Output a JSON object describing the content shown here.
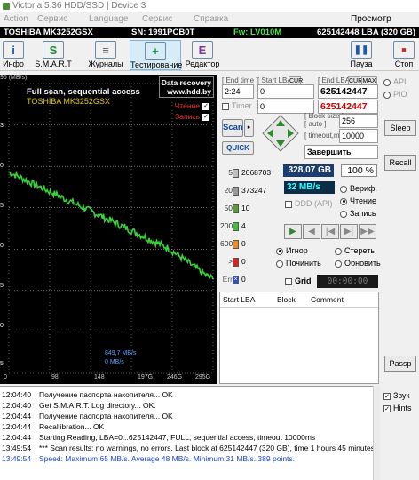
{
  "window": {
    "title": "Victoria 5.36 HDD/SSD | Device 3"
  },
  "menu": [
    "Action",
    "Сервис",
    "Language",
    "Сервис",
    "Справка",
    "Просмотр буфера"
  ],
  "info": {
    "model": "TOSHIBA MK3252GSX",
    "serial": "SN: 1991PCB0T",
    "firmware": "Fw: LV010M",
    "capacity": "625142448 LBA (320 GB)"
  },
  "toolbar": {
    "items": [
      {
        "label": "Инфо",
        "icon": "i"
      },
      {
        "label": "S.M.A.R.T",
        "icon": "S"
      },
      {
        "label": "Журналы",
        "icon": "≡"
      },
      {
        "label": "Тестирование",
        "icon": "+"
      },
      {
        "label": "Редактор",
        "icon": "E"
      }
    ],
    "pause": "Пауза",
    "stop": "Стоп"
  },
  "graph": {
    "unit": "95 (MB/s)",
    "title": "Full scan, sequential access",
    "model": "TOSHIBA MK3252GSX",
    "recovery_line1": "Data recovery",
    "recovery_line2": "www.hdd.by",
    "read_label": "Чтение",
    "write_label": "Запись",
    "speed_readout": "849,7 MB/s",
    "speed_readout2": "0 MB/s",
    "y_ticks": [
      "3",
      "0",
      "5",
      "0",
      "5",
      "0",
      "5"
    ],
    "x_ticks": [
      "0",
      "98",
      "148",
      "197G",
      "246G",
      "295G"
    ],
    "colors": {
      "line": "#3bd23b",
      "grid": "#a8a8a8"
    }
  },
  "chart_data": {
    "type": "line",
    "title": "Full scan, sequential access",
    "ylabel": "(MB/s)",
    "xlabel": "",
    "xlim": [
      0,
      320
    ],
    "ylim": [
      0,
      95
    ],
    "x": [
      0,
      10,
      20,
      30,
      40,
      50,
      60,
      70,
      80,
      90,
      100,
      110,
      120,
      130,
      140,
      150,
      160,
      170,
      180,
      190,
      200,
      210,
      220,
      230,
      240,
      250,
      260,
      270,
      280,
      290,
      300,
      310,
      320
    ],
    "series": [
      {
        "values": [
          66,
          65,
          64,
          63,
          62,
          61,
          60,
          59,
          58,
          57,
          56,
          55,
          54,
          53,
          52,
          51,
          50,
          49,
          48,
          47,
          46,
          45,
          44,
          43,
          42,
          41,
          39.5,
          38,
          36.5,
          35,
          33.5,
          32,
          31
        ]
      }
    ]
  },
  "ctrl": {
    "end_time_label": "[ End time ]",
    "end_time_value": "2:24",
    "timer_label": "Timer",
    "timer_value": "0",
    "start_lba_label": "[ Start LBA ]",
    "start_lba_value": "0",
    "end_lba_label": "[ End LBA ]",
    "end_lba_value": "625142447",
    "end_lba_value2": "625142447",
    "cur_label": "CUR",
    "max_label": "MAX",
    "scan_label": "Scan",
    "quick_label": "QUICK",
    "block_size_label": "[ block size ]",
    "auto_label": "[ auto ]",
    "block_size_value": "256",
    "timeout_label": "[ timeout,ms ]",
    "timeout_value": "10000",
    "finish_value": "Завершить"
  },
  "legend": [
    {
      "label": "5",
      "count": "2068703",
      "color": "#bfbfbf"
    },
    {
      "label": "20",
      "count": "373247",
      "color": "#9a9a9a"
    },
    {
      "label": "50",
      "count": "10",
      "color": "#5a9c3a"
    },
    {
      "label": "200",
      "count": "4",
      "color": "#3ac03a"
    },
    {
      "label": "600",
      "count": "0",
      "color": "#f08a1a"
    },
    {
      "label": ">",
      "count": "0",
      "color": "#e02020"
    },
    {
      "label": "Err",
      "count": "0",
      "color": "#2a50c8"
    }
  ],
  "status": {
    "size": "328,07 GB",
    "percent": "100",
    "percent_unit": "%",
    "speed": "32 MB/s",
    "verify": "Вериф.",
    "read": "Чтение",
    "write": "Запись",
    "ddd": "DDD (API)",
    "ignore": "Игнор",
    "erase": "Стереть",
    "fix": "Починить",
    "refresh": "Обновить",
    "grid": "Grid",
    "grid_time": "00:00:00"
  },
  "table": {
    "headers": [
      "Start LBA",
      "Block",
      "Comment"
    ]
  },
  "right": {
    "api": "API",
    "pio": "PIO",
    "sleep": "Sleep",
    "recall": "Recall",
    "passp": "Passp",
    "sound": "Звук",
    "hints": "Hints"
  },
  "log": [
    {
      "time": "12:04:40",
      "text": "Получение паспорта накопителя... OK",
      "blue": false
    },
    {
      "time": "12:04:40",
      "text": "Get S.M.A.R.T. Log directory... OK.",
      "blue": false
    },
    {
      "time": "12:04:44",
      "text": "Получение паспорта накопителя... OK",
      "blue": false
    },
    {
      "time": "12:04:44",
      "text": "Recallibration... OK",
      "blue": false
    },
    {
      "time": "12:04:44",
      "text": "Starting Reading, LBA=0...625142447, FULL, sequential access, timeout 10000ms",
      "blue": false
    },
    {
      "time": "13:49:54",
      "text": "*** Scan results: no warnings, no errors. Last block at 625142447 (320 GB), time 1 hours 45 minutes.",
      "blue": false
    },
    {
      "time": "13:49:54",
      "text": "Speed: Maximum 65 MB/s. Average 48 MB/s. Minimum 31 MB/s. 389 points.",
      "blue": true
    }
  ]
}
